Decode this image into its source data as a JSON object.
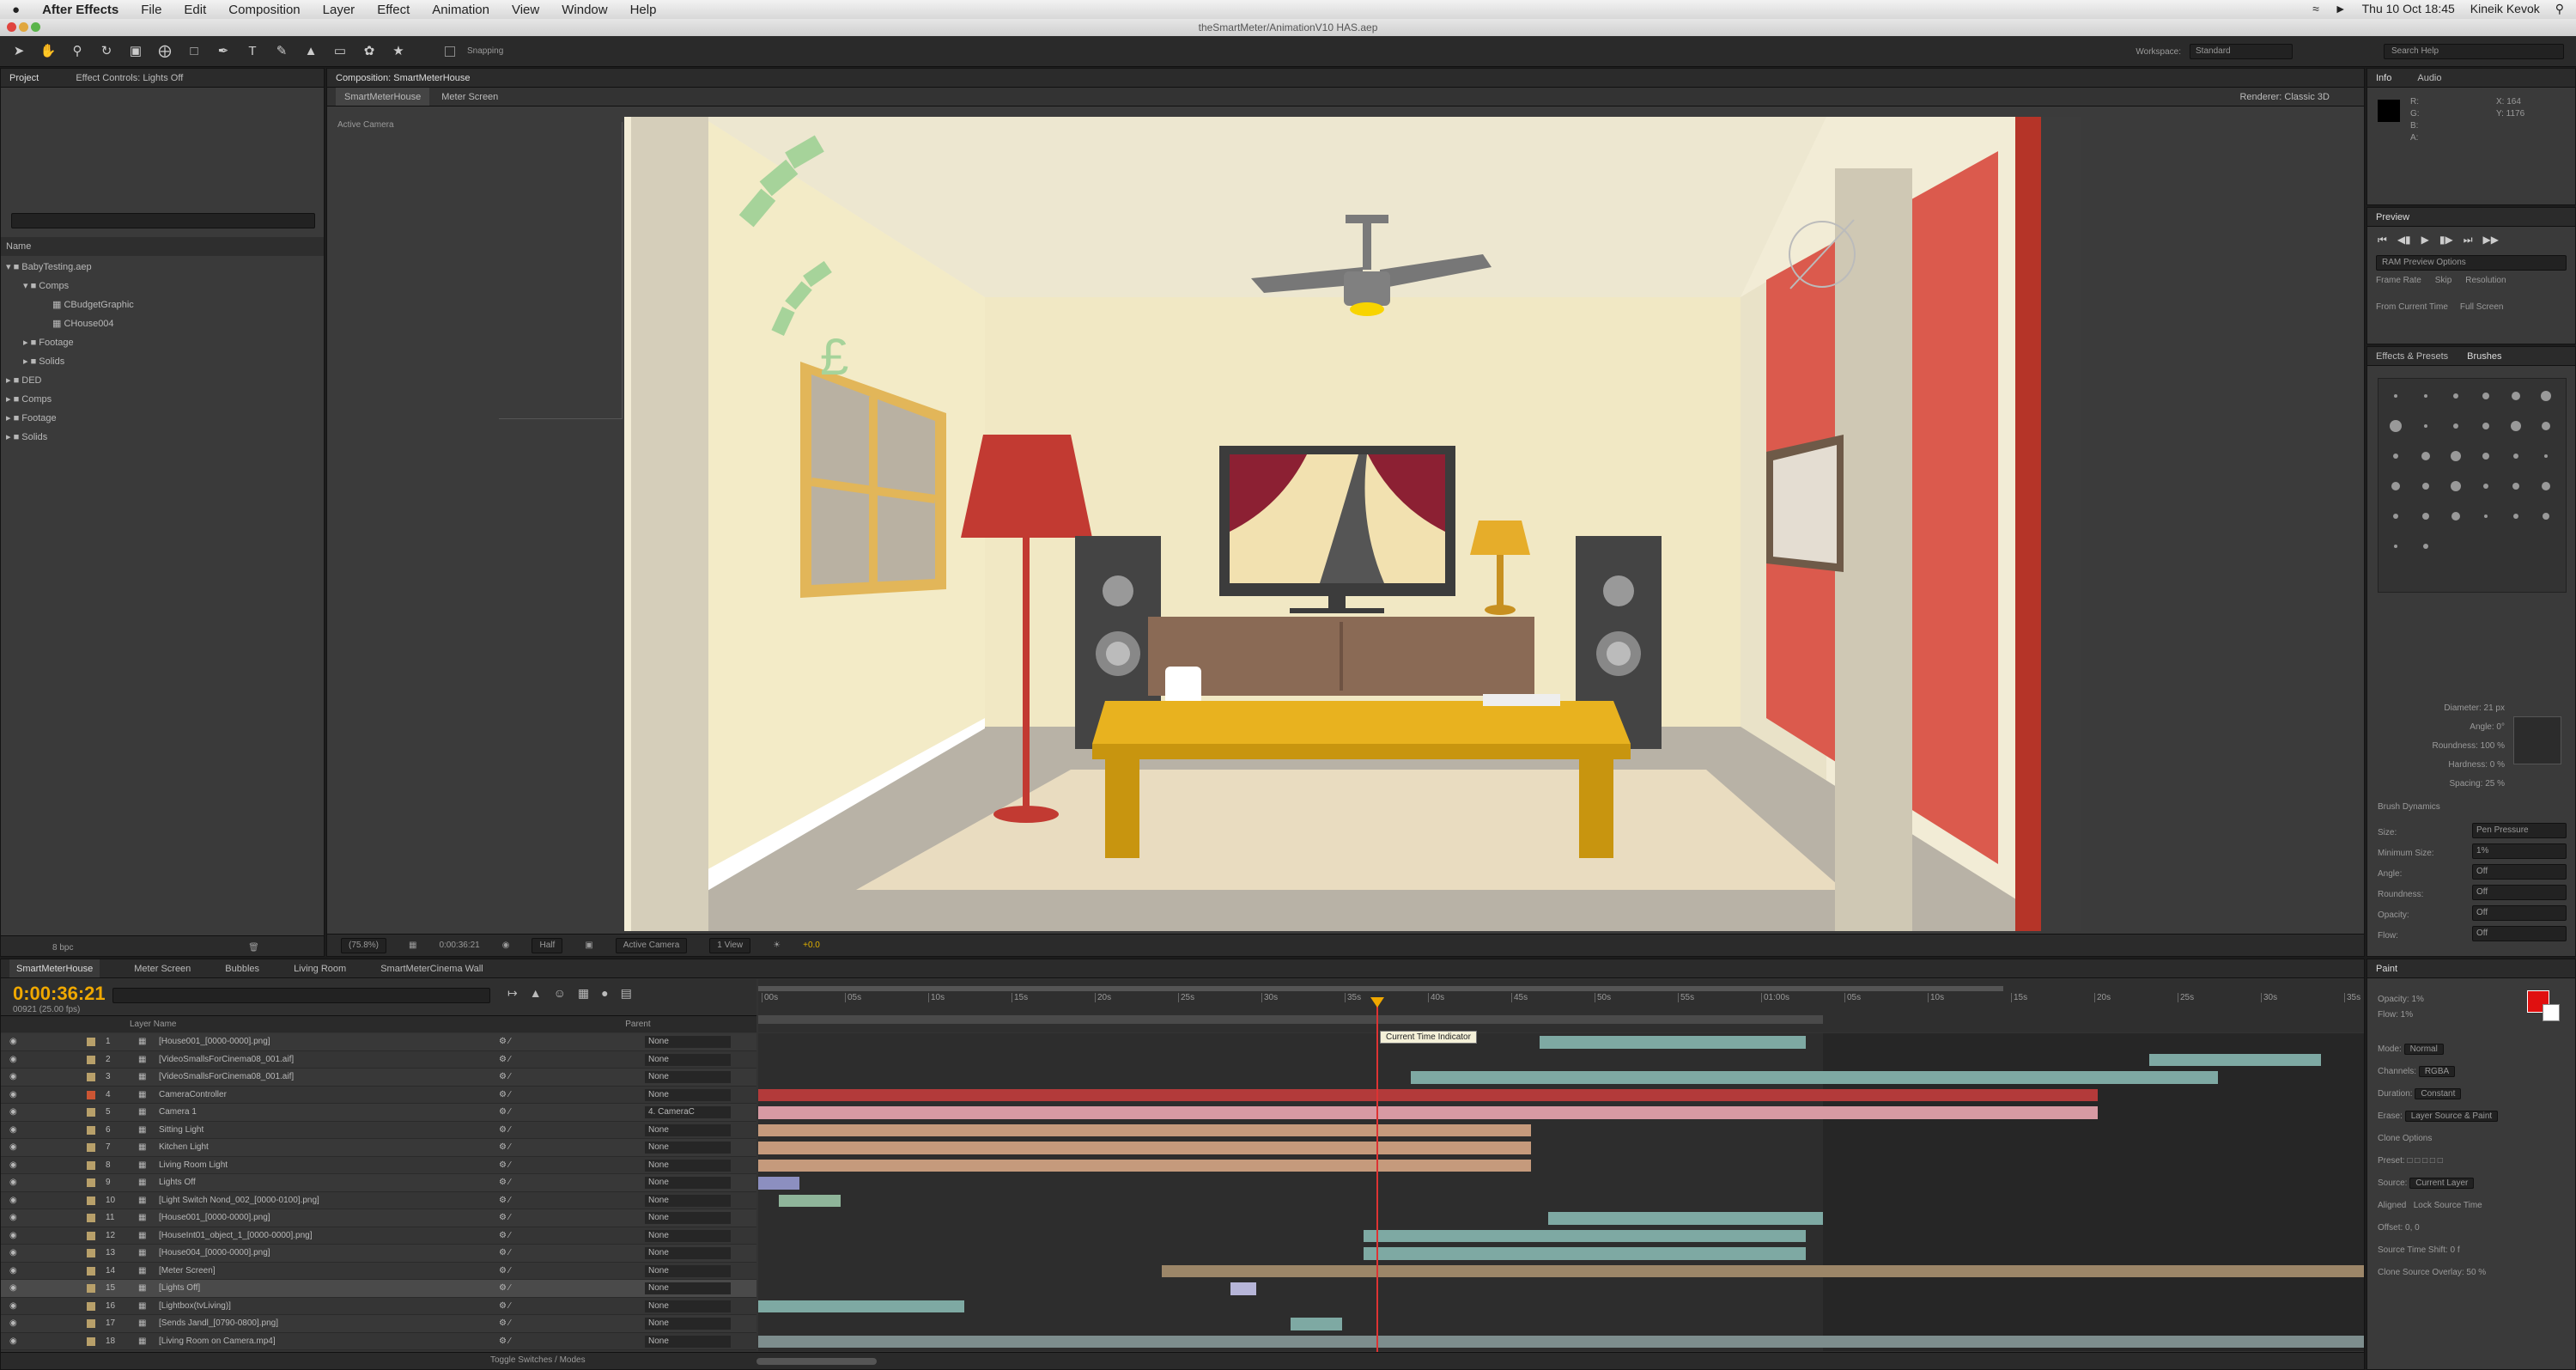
{
  "menubar": {
    "apple": "",
    "app": "After Effects",
    "items": [
      "File",
      "Edit",
      "Composition",
      "Layer",
      "Effect",
      "Animation",
      "View",
      "Window",
      "Help"
    ],
    "clock": "Thu 10 Oct 18:45",
    "user": "Kineik Kevok"
  },
  "window": {
    "title": "theSmartMeter/AnimationV10 HAS.aep"
  },
  "toolbar": {
    "snapping": "Snapping",
    "workspace_label": "Workspace:",
    "workspace_value": "Standard",
    "search_help": "Search Help"
  },
  "project": {
    "tab1": "Project",
    "tab2": "Effect Controls: Lights Off",
    "column": "Name",
    "search_placeholder": "",
    "items": [
      "BabyTesting.aep",
      "Comps",
      "CBudgetGraphic",
      "CHouse004",
      "Footage",
      "Solids",
      "DED",
      "Comps",
      "Footage",
      "Solids"
    ],
    "bpc": "8 bpc"
  },
  "composition": {
    "tab": "Composition: SmartMeterHouse",
    "subtab1": "SmartMeterHouse",
    "subtab2": "Meter Screen",
    "active_camera": "Active Camera",
    "renderer_label": "Renderer:",
    "renderer_value": "Classic 3D",
    "footer": {
      "zoom": "(75.8%)",
      "timecode": "0:00:36:21",
      "res": "Half",
      "camera": "Active Camera",
      "view": "1 View",
      "exposure": "+0.0"
    }
  },
  "info": {
    "tab1": "Info",
    "tab2": "Audio",
    "r": "R:",
    "g": "G:",
    "b": "B:",
    "a": "A:",
    "x": "X: 164",
    "y": "Y: 1176"
  },
  "preview": {
    "tab": "Preview",
    "ram_options": "RAM Preview Options",
    "frame_rate": "Frame Rate",
    "skip": "Skip",
    "resolution": "Resolution",
    "from_current": "From Current Time",
    "full_screen": "Full Screen"
  },
  "brushes": {
    "tab1": "Effects & Presets",
    "tab2": "Brushes",
    "props": [
      "Diameter: 21 px",
      "Angle: 0°",
      "Roundness: 100 %",
      "Hardness: 0 %",
      "Spacing: 25 %"
    ],
    "dynamics": "Brush Dynamics",
    "dyn_rows": [
      "Size:",
      "Minimum Size:",
      "Angle:",
      "Roundness:",
      "Opacity:",
      "Flow:"
    ],
    "dyn_values": [
      "Pen Pressure",
      "1%",
      "Off",
      "Off",
      "Off",
      "Off"
    ]
  },
  "paint": {
    "tab": "Paint",
    "opacity": "Opacity: 1%",
    "flow": "Flow: 1%",
    "mode_label": "Mode:",
    "mode": "Normal",
    "channels_label": "Channels:",
    "channels": "RGBA",
    "duration_label": "Duration:",
    "duration": "Constant",
    "erase_label": "Erase:",
    "erase": "Layer Source & Paint",
    "clone_options": "Clone Options",
    "preset": "Preset:",
    "source": "Source:",
    "source_val": "Current Layer",
    "aligned": "Aligned",
    "lock_source": "Lock Source Time",
    "offset": "Offset: 0, 0",
    "source_time": "Source Time Shift: 0 f",
    "clone_overlay": "Clone Source Overlay: 50 %"
  },
  "timeline": {
    "tabs": [
      "SmartMeterHouse",
      "Meter Screen",
      "Bubbles",
      "Living Room",
      "SmartMeterCinema Wall"
    ],
    "timecode": "0:00:36:21",
    "frame": "00921 (25.00 fps)",
    "col_layer_name": "Layer Name",
    "col_parent": "Parent",
    "tooltip": "Current Time Indicator",
    "toggle": "Toggle Switches / Modes",
    "ruler": [
      "00s",
      "05s",
      "10s",
      "15s",
      "20s",
      "25s",
      "30s",
      "35s",
      "40s",
      "45s",
      "50s",
      "55s",
      "01:00s",
      "05s",
      "10s",
      "15s",
      "20s",
      "25s",
      "30s",
      "35s"
    ],
    "layers": [
      {
        "n": "1",
        "name": "[House001_[0000-0000].png]",
        "parent": "None"
      },
      {
        "n": "2",
        "name": "[VideoSmallsForCinema08_001.aif]",
        "parent": "None"
      },
      {
        "n": "3",
        "name": "[VideoSmallsForCinema08_001.aif]",
        "parent": "None"
      },
      {
        "n": "4",
        "name": "CameraController",
        "parent": "None"
      },
      {
        "n": "5",
        "name": "Camera 1",
        "parent": "4. CameraC"
      },
      {
        "n": "6",
        "name": "Sitting Light",
        "parent": "None"
      },
      {
        "n": "7",
        "name": "Kitchen Light",
        "parent": "None"
      },
      {
        "n": "8",
        "name": "Living Room Light",
        "parent": "None"
      },
      {
        "n": "9",
        "name": "Lights Off",
        "parent": "None"
      },
      {
        "n": "10",
        "name": "[Light Switch Nond_002_[0000-0100].png]",
        "parent": "None"
      },
      {
        "n": "11",
        "name": "[House001_[0000-0000].png]",
        "parent": "None"
      },
      {
        "n": "12",
        "name": "[HouseInt01_object_1_[0000-0000].png]",
        "parent": "None"
      },
      {
        "n": "13",
        "name": "[House004_[0000-0000].png]",
        "parent": "None"
      },
      {
        "n": "14",
        "name": "[Meter Screen]",
        "parent": "None"
      },
      {
        "n": "15",
        "name": "[Lights Off]",
        "parent": "None"
      },
      {
        "n": "16",
        "name": "[Lightbox(tvLiving)]",
        "parent": "None"
      },
      {
        "n": "17",
        "name": "[Sends Jandl_[0790-0800].png]",
        "parent": "None"
      },
      {
        "n": "18",
        "name": "[Living Room on Camera.mp4]",
        "parent": "None"
      }
    ]
  },
  "colors": {
    "panel": "#3a3a3a",
    "dark": "#262626",
    "accent": "#f0a800",
    "playhead": "#d33"
  }
}
